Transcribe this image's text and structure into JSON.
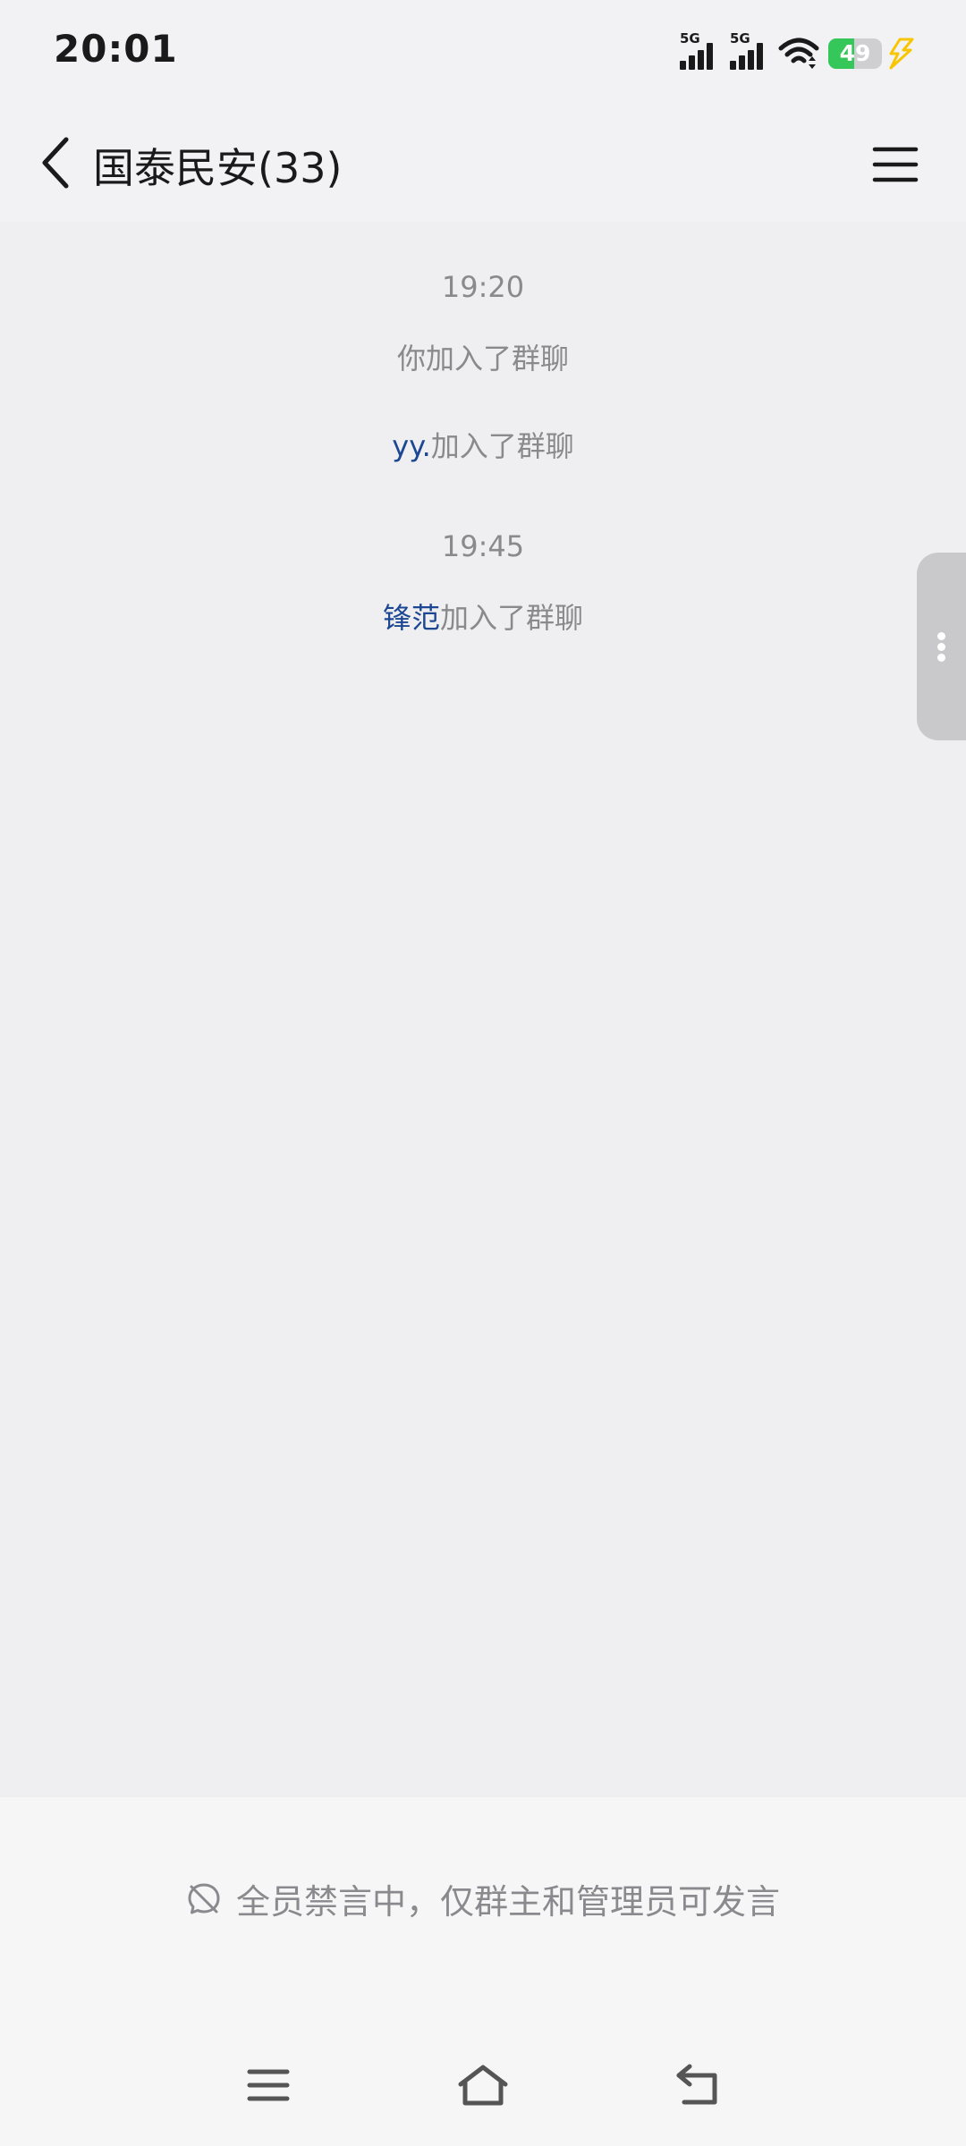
{
  "status_bar": {
    "time": "20:01",
    "signal_1_label": "5G",
    "signal_2_label": "5G",
    "battery_percent": "49",
    "battery_level": 0.49,
    "icons": [
      "signal-icon",
      "signal-icon",
      "wifi-icon",
      "battery-icon",
      "charging-icon"
    ]
  },
  "header": {
    "title": "国泰民安(33)",
    "back_icon": "chevron-left-icon",
    "menu_icon": "hamburger-menu-icon"
  },
  "chat": {
    "events": [
      {
        "time": "19:20"
      },
      {
        "text": "你加入了群聊"
      },
      {
        "name": "yy.",
        "suffix": "加入了群聊"
      },
      {
        "time": "19:45"
      },
      {
        "name": "锋范",
        "suffix": "加入了群聊"
      }
    ]
  },
  "side_handle": {
    "icon": "more-vertical-icon"
  },
  "footer": {
    "muted_notice": "全员禁言中，仅群主和管理员可发言",
    "muted_icon": "muted-chat-icon"
  },
  "nav_bar": {
    "icons": [
      "recent-apps-icon",
      "home-icon",
      "back-icon"
    ]
  },
  "colors": {
    "background": "#efeff1",
    "name_link": "#1d4793",
    "system_text": "#8a8a8e",
    "battery_green": "#35c759",
    "charging_yellow": "#f7c600"
  }
}
